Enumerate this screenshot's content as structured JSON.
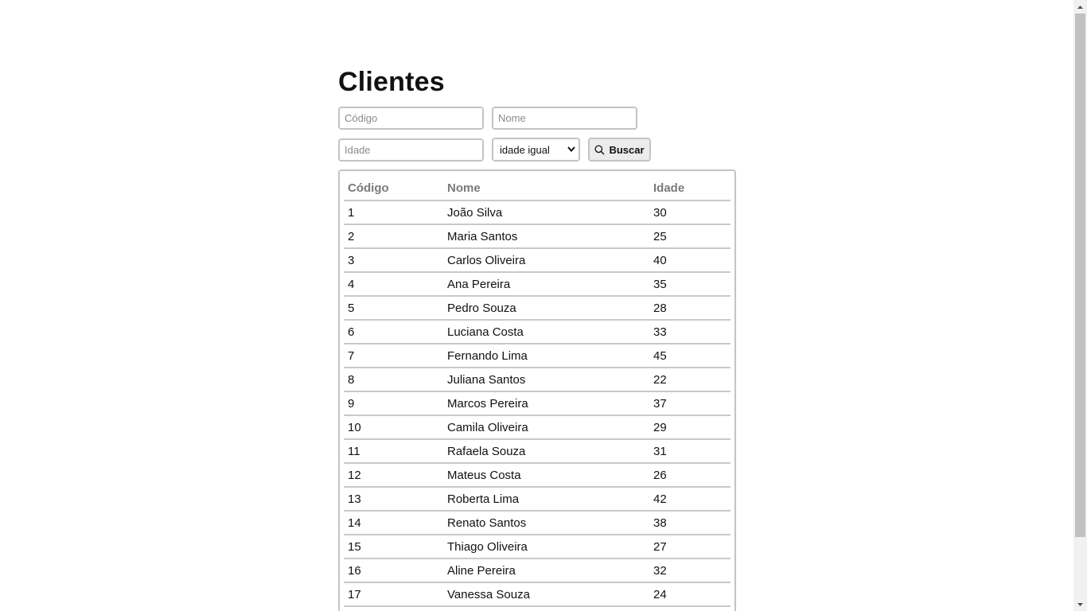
{
  "page": {
    "title": "Clientes"
  },
  "filters": {
    "code_placeholder": "Código",
    "name_placeholder": "Nome",
    "age_placeholder": "Idade",
    "age_mode_selected": "idade igual",
    "search_label": "Buscar",
    "search_icon": "search-icon"
  },
  "table": {
    "headers": {
      "code": "Código",
      "name": "Nome",
      "age": "Idade"
    },
    "rows": [
      {
        "code": "1",
        "name": "João Silva",
        "age": "30"
      },
      {
        "code": "2",
        "name": "Maria Santos",
        "age": "25"
      },
      {
        "code": "3",
        "name": "Carlos Oliveira",
        "age": "40"
      },
      {
        "code": "4",
        "name": "Ana Pereira",
        "age": "35"
      },
      {
        "code": "5",
        "name": "Pedro Souza",
        "age": "28"
      },
      {
        "code": "6",
        "name": "Luciana Costa",
        "age": "33"
      },
      {
        "code": "7",
        "name": "Fernando Lima",
        "age": "45"
      },
      {
        "code": "8",
        "name": "Juliana Santos",
        "age": "22"
      },
      {
        "code": "9",
        "name": "Marcos Pereira",
        "age": "37"
      },
      {
        "code": "10",
        "name": "Camila Oliveira",
        "age": "29"
      },
      {
        "code": "11",
        "name": "Rafaela Souza",
        "age": "31"
      },
      {
        "code": "12",
        "name": "Mateus Costa",
        "age": "26"
      },
      {
        "code": "13",
        "name": "Roberta Lima",
        "age": "42"
      },
      {
        "code": "14",
        "name": "Renato Santos",
        "age": "38"
      },
      {
        "code": "15",
        "name": "Thiago Oliveira",
        "age": "27"
      },
      {
        "code": "16",
        "name": "Aline Pereira",
        "age": "32"
      },
      {
        "code": "17",
        "name": "Vanessa Souza",
        "age": "24"
      }
    ]
  },
  "colors": {
    "border": "#c4c4c4",
    "header_text": "#7a7a7a",
    "button_bg": "#ececec"
  }
}
